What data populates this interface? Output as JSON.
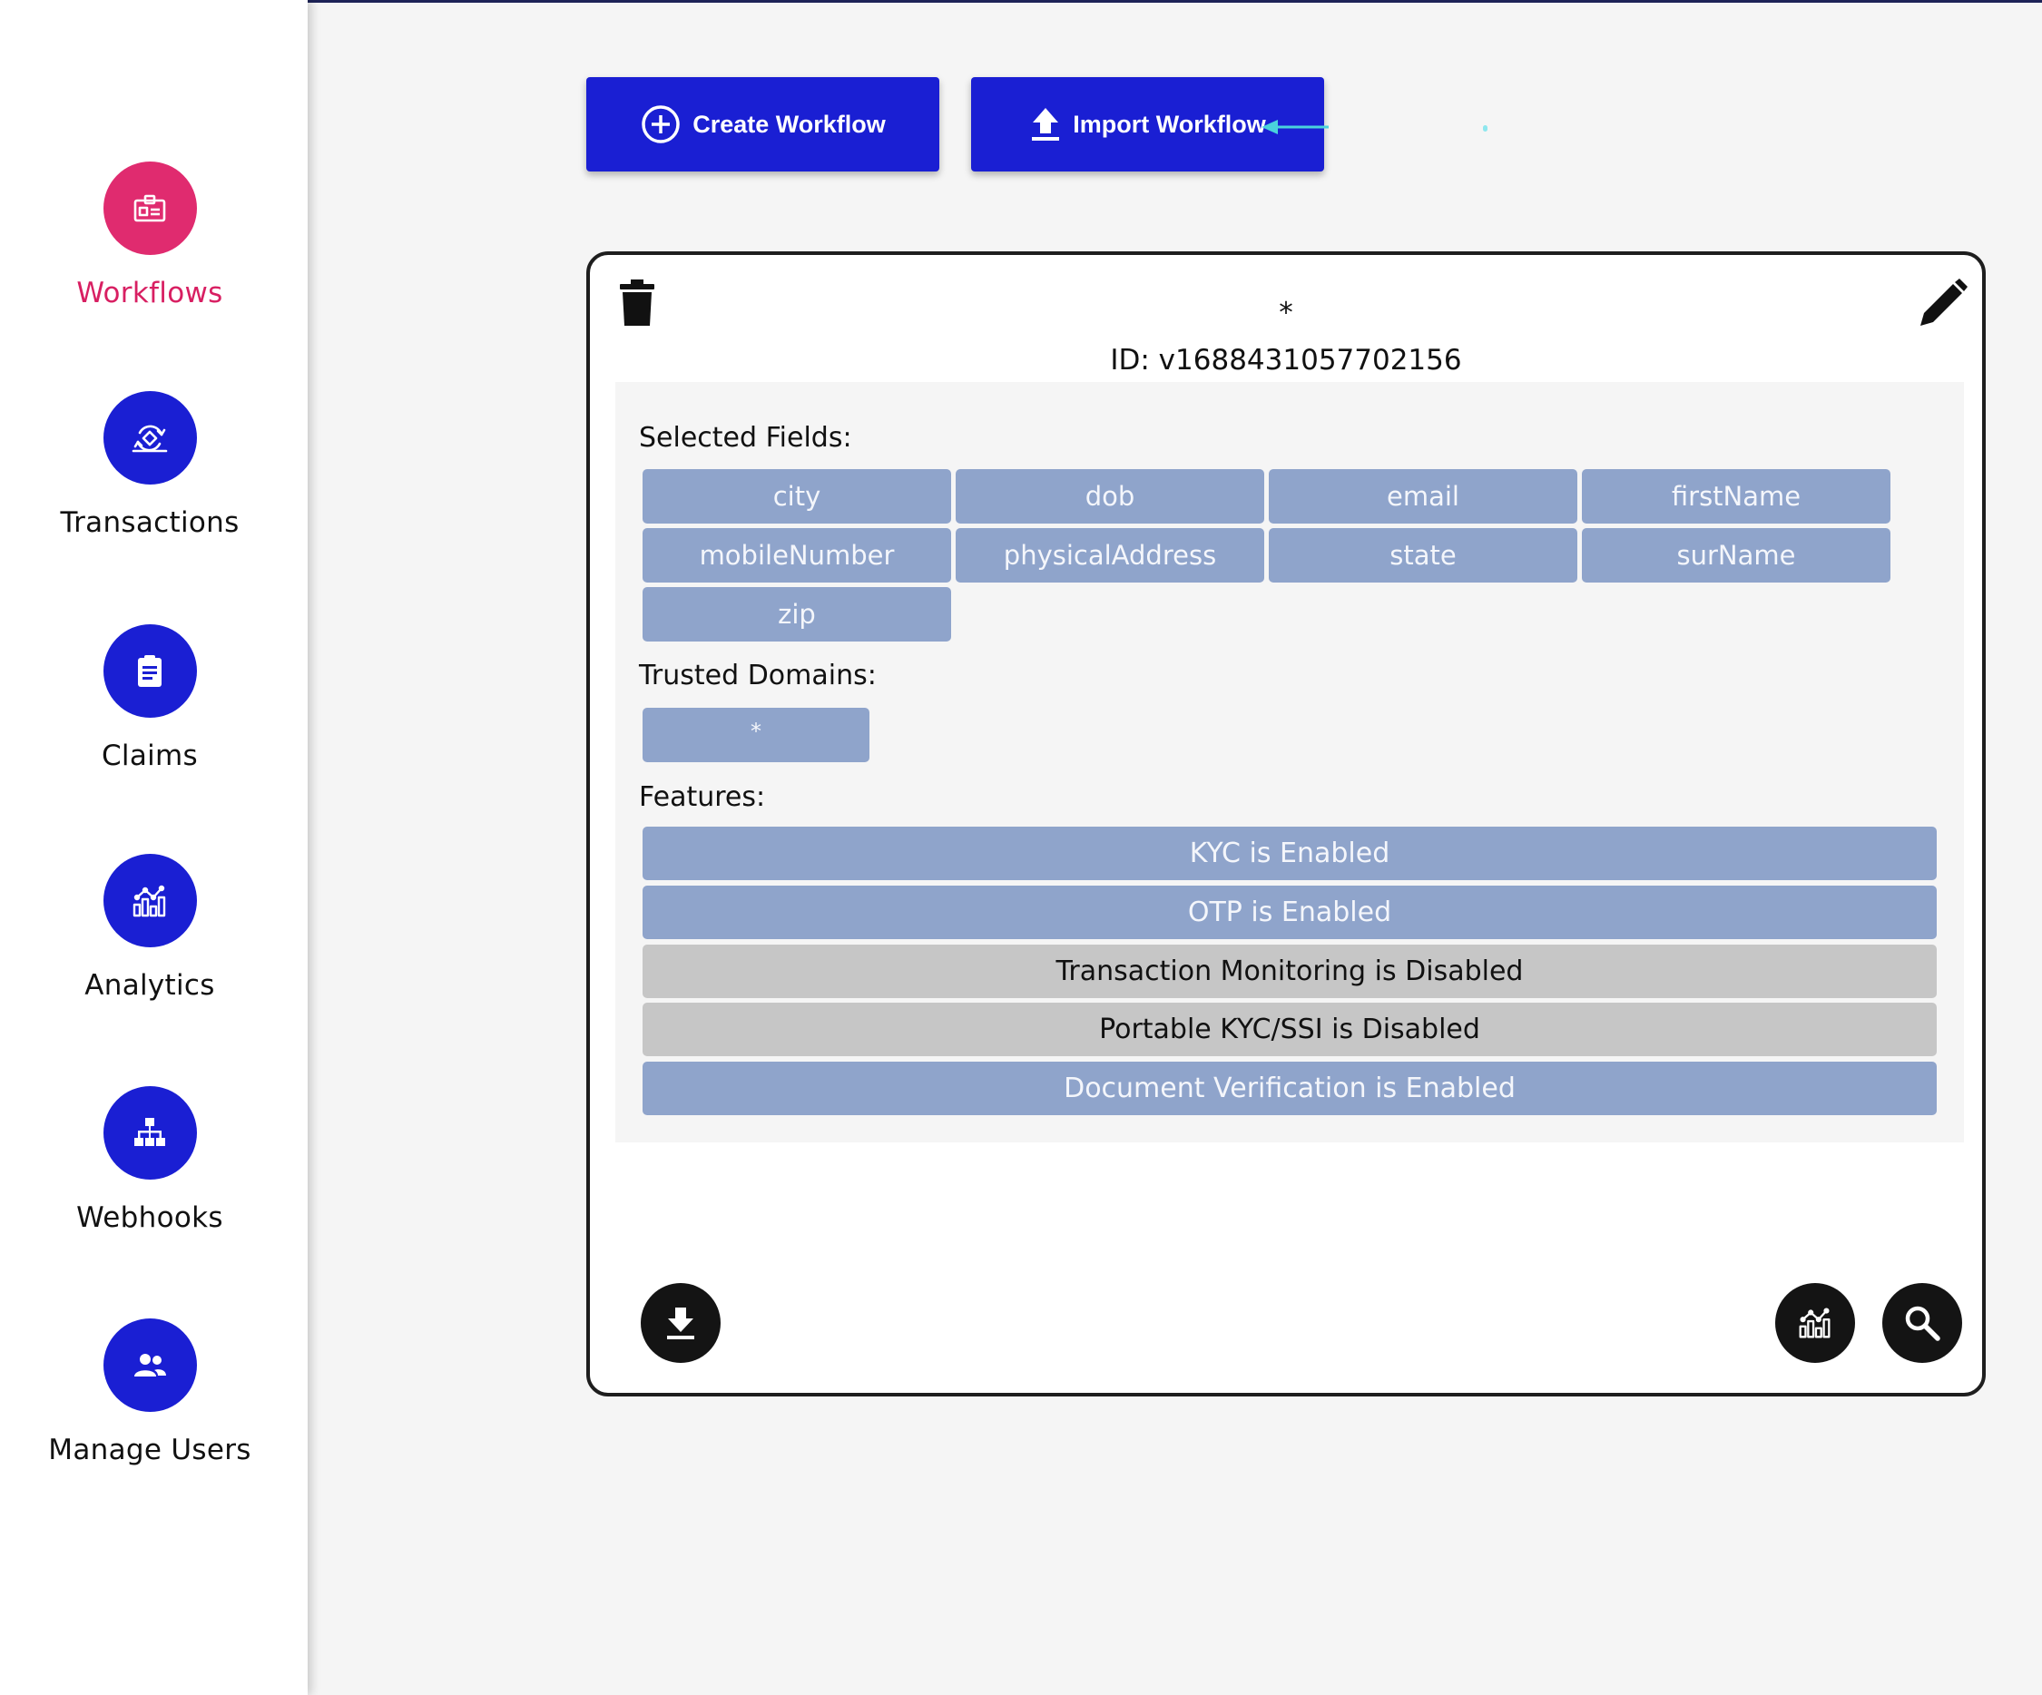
{
  "sidebar": {
    "items": [
      {
        "label": "Workflows",
        "icon": "id-card-icon",
        "active": true
      },
      {
        "label": "Transactions",
        "icon": "transactions-icon",
        "active": false
      },
      {
        "label": "Claims",
        "icon": "clipboard-icon",
        "active": false
      },
      {
        "label": "Analytics",
        "icon": "analytics-icon",
        "active": false
      },
      {
        "label": "Webhooks",
        "icon": "webhook-icon",
        "active": false
      },
      {
        "label": "Manage Users",
        "icon": "users-icon",
        "active": false
      }
    ]
  },
  "toolbar": {
    "create_label": "Create Workflow",
    "import_label": "Import Workflow"
  },
  "workflow": {
    "name": "*",
    "id_text": "ID: v1688431057702156",
    "selected_fields_title": "Selected Fields:",
    "selected_fields": [
      "city",
      "dob",
      "email",
      "firstName",
      "mobileNumber",
      "physicalAddress",
      "state",
      "surName",
      "zip"
    ],
    "trusted_domains_title": "Trusted Domains:",
    "trusted_domains": [
      "*"
    ],
    "features_title": "Features:",
    "features": [
      {
        "label": "KYC is Enabled",
        "enabled": true
      },
      {
        "label": "OTP is Enabled",
        "enabled": true
      },
      {
        "label": "Transaction Monitoring is Disabled",
        "enabled": false
      },
      {
        "label": "Portable KYC/SSI is Disabled",
        "enabled": false
      },
      {
        "label": "Document Verification is Enabled",
        "enabled": true
      }
    ]
  },
  "colors": {
    "primary": "#1a1fd3",
    "active": "#e02b6f",
    "chip": "#8fa4cb",
    "disabled": "#c6c6c6"
  }
}
